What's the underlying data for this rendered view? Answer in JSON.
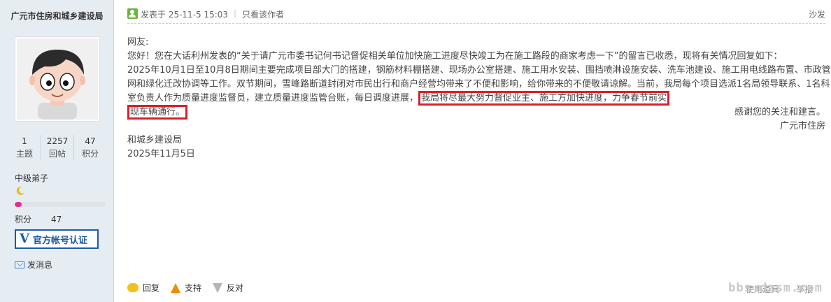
{
  "sidebar": {
    "author": "广元市住房和城乡建设局",
    "stats": [
      {
        "num": "1",
        "label": "主题"
      },
      {
        "num": "2257",
        "label": "回帖"
      },
      {
        "num": "47",
        "label": "积分"
      }
    ],
    "rank": "中级弟子",
    "progress_fraction": 0.08,
    "credits_label": "积分",
    "credits_value": "47",
    "badge_v": "V",
    "badge_text": "官方帐号认证",
    "send_message": "发消息"
  },
  "post": {
    "posted_at": "发表于 25-11-5 15:03",
    "only_author": "只看该作者",
    "floor": "沙发",
    "greeting": "网友:",
    "para1": "您好！您在大话利州发表的“关于请广元市委书记何书记督促相关单位加快施工进度尽快竣工为在施工路段的商家考虑一下”的留言已收悉，现将有关情况回复如下：",
    "para2_start": "2025年10月1日至10月8日期间主要完成项目部大门的搭建，钢筋材料棚搭建、现场办公室搭建、施工用水安装、围挡喷淋设施安装、洗车池建设、施工用电线路布置、市政管网和绿化迁改协调等工作。双节期间，雪峰路断道封闭对市民出行和商户经营均带来了不便和影响，给你带来的不便敬请谅解。当前，我局每个项目选派1名局领导联系、1名科室负责人作为质量进度监督员，建立质量进度监管台账，每日调度进展，",
    "highlight_a": "我局将尽最大努力督促业主、施工方加快进度，力争春节前实",
    "highlight_b": "现车辆通行。",
    "thanks": "感谢您的关注和建言。",
    "sign1": "广元市住房",
    "sign2": "和城乡建设局",
    "date": "2025年11月5日"
  },
  "actions": {
    "reply": "回复",
    "support": "支持",
    "oppose": "反对"
  },
  "footer": {
    "link1": "使用道具",
    "link2": "举报",
    "watermark": "bbs.dzsm.com"
  },
  "colors": {
    "sidebar_bg": "#e5edf2",
    "highlight_border": "#d8202a",
    "badge_blue": "#1b5aa8"
  }
}
